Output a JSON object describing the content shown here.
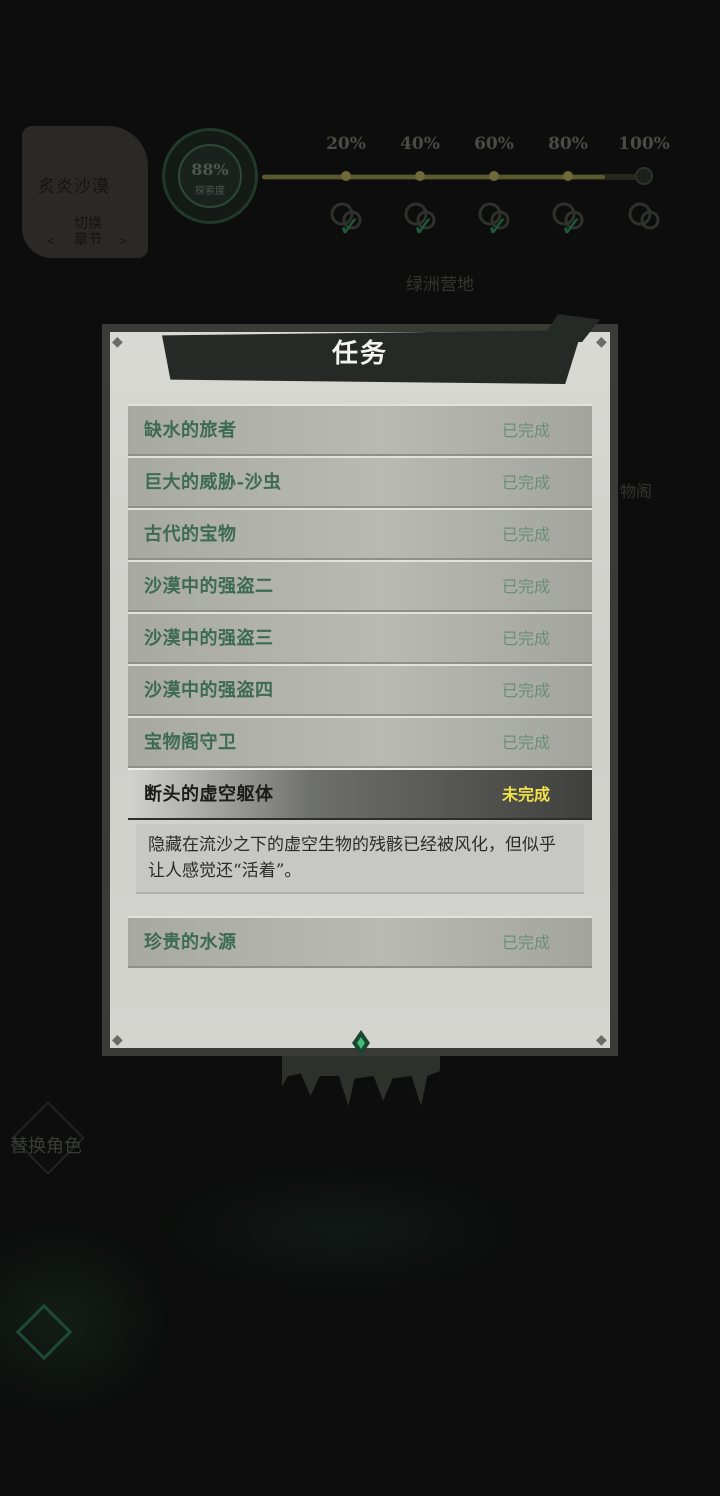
{
  "chapter": {
    "title": "炙炎沙漠",
    "switch_label": "切换\n章节",
    "arrow_left": "<",
    "arrow_right": ">"
  },
  "progress": {
    "value_percent": 88,
    "percent_text": "88%",
    "label": "探索度",
    "milestones": [
      "20%",
      "40%",
      "60%",
      "80%",
      "100%"
    ],
    "reward_icons": [
      "reward-coin-icon",
      "reward-coin-icon",
      "reward-coin-icon",
      "reward-coin-icon",
      "reward-item-icon"
    ],
    "claimed": [
      true,
      true,
      true,
      true,
      false
    ]
  },
  "map": {
    "region_label": "绿洲营地",
    "side_label": "物阁",
    "switch_role": "替换角色"
  },
  "modal": {
    "title": "任务",
    "quests": [
      {
        "name": "缺水的旅者",
        "status": "已完成",
        "active": false
      },
      {
        "name": "巨大的威胁-沙虫",
        "status": "已完成",
        "active": false
      },
      {
        "name": "古代的宝物",
        "status": "已完成",
        "active": false
      },
      {
        "name": "沙漠中的强盗二",
        "status": "已完成",
        "active": false
      },
      {
        "name": "沙漠中的强盗三",
        "status": "已完成",
        "active": false
      },
      {
        "name": "沙漠中的强盗四",
        "status": "已完成",
        "active": false
      },
      {
        "name": "宝物阁守卫",
        "status": "已完成",
        "active": false
      },
      {
        "name": "断头的虚空躯体",
        "status": "未完成",
        "active": true
      }
    ],
    "active_description": "隐藏在流沙之下的虚空生物的残骸已经被风化，但似乎让人感觉还“活着”。",
    "quests_after": [
      {
        "name": "珍贵的水源",
        "status": "已完成",
        "active": false
      }
    ]
  },
  "colors": {
    "accent_incomplete": "#f1e14a",
    "quest_name_green": "#3c6a52",
    "gem_green": "#3fbf73"
  }
}
